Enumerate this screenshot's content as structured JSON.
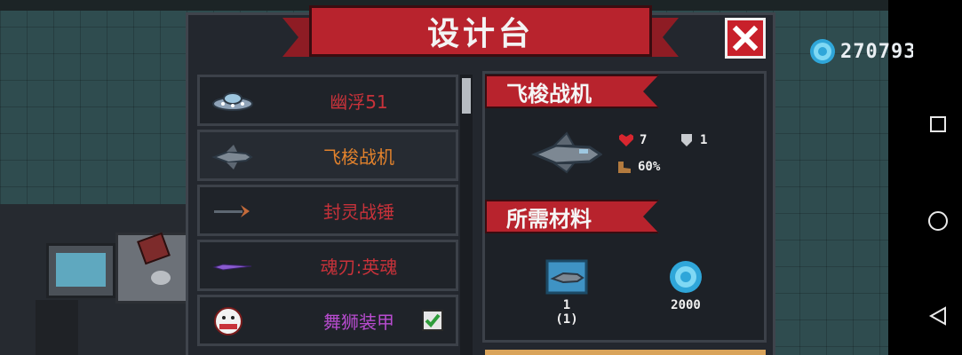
{
  "header": {
    "title": "设计台",
    "close_label": "✕"
  },
  "currency": {
    "icon": "gem-icon",
    "value": "270793",
    "color": "#4fc3e8"
  },
  "weapon_list": {
    "items": [
      {
        "label": "幽浮51",
        "color": "#c8323a",
        "icon": "ufo-icon",
        "selected": false,
        "owned": false
      },
      {
        "label": "飞梭战机",
        "color": "#e2822c",
        "icon": "jet-icon",
        "selected": true,
        "owned": false
      },
      {
        "label": "封灵战锤",
        "color": "#c8323a",
        "icon": "hammer-icon",
        "selected": false,
        "owned": false
      },
      {
        "label": "魂刃:英魂",
        "color": "#c8323a",
        "icon": "blade-icon",
        "selected": false,
        "owned": false
      },
      {
        "label": "舞狮装甲",
        "color": "#b84ccf",
        "icon": "lion-icon",
        "selected": false,
        "owned": true
      }
    ]
  },
  "details": {
    "name": "飞梭战机",
    "stats": {
      "hp": "7",
      "armor": "1",
      "speed": "60%"
    },
    "materials_title": "所需材料",
    "materials": [
      {
        "icon": "blueprint-icon",
        "count_top": "1",
        "count_bottom": "(1)"
      },
      {
        "icon": "gem-icon",
        "count": "2000"
      }
    ]
  }
}
